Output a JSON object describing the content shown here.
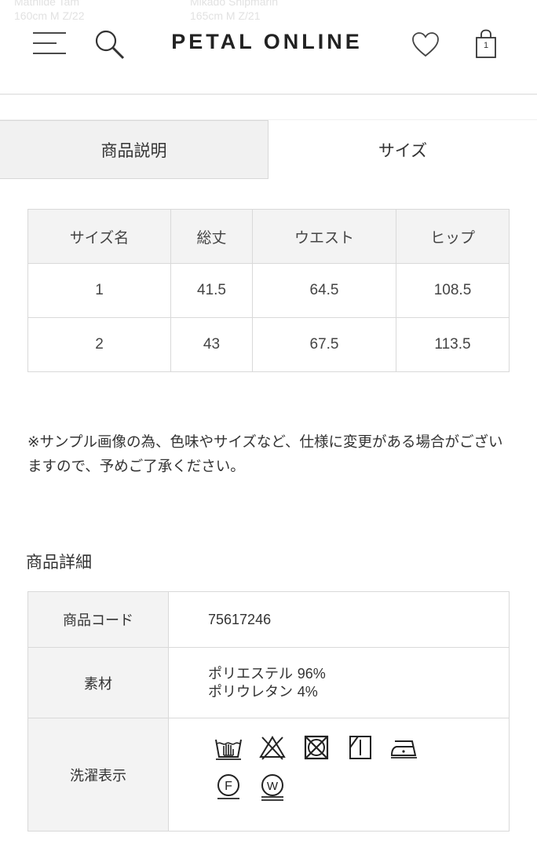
{
  "ghost": {
    "line1": "Mathilde Tam",
    "line2": "160cm   M Z/22",
    "line3": "Mikado Shipmarin",
    "line4": "165cm   M Z/21"
  },
  "header": {
    "logo": "PETAL ONLINE",
    "cart_count": "1",
    "icons": [
      "menu-icon",
      "search-icon",
      "heart-icon",
      "shopping-bag-icon"
    ]
  },
  "tabs": [
    {
      "label": "商品説明",
      "active": false
    },
    {
      "label": "サイズ",
      "active": true
    }
  ],
  "size_table": {
    "headers": [
      "サイズ名",
      "総丈",
      "ウエスト",
      "ヒップ"
    ],
    "rows": [
      [
        "1",
        "41.5",
        "64.5",
        "108.5"
      ],
      [
        "2",
        "43",
        "67.5",
        "113.5"
      ]
    ]
  },
  "note": "※サンプル画像の為、色味やサイズなど、仕様に変更がある場合がございますので、予めご了承ください。",
  "details": {
    "heading": "商品詳細",
    "code_label": "商品コード",
    "code_value": "75617246",
    "material_label": "素材",
    "material_lines": [
      {
        "name": "ポリエステル",
        "pct": "96%"
      },
      {
        "name": "ポリウレタン",
        "pct": "4%"
      }
    ],
    "care_label": "洗濯表示",
    "care_icons": [
      "hand-wash-icon",
      "no-bleach-icon",
      "no-tumble-dry-icon",
      "shade-line-dry-icon",
      "low-iron-icon",
      "dry-clean-f-icon",
      "wet-clean-w-icon"
    ],
    "care_letters": {
      "dry_clean": "F",
      "wet_clean": "W"
    }
  },
  "colors": {
    "text": "#333333",
    "border": "#d9d9d9",
    "header_cell": "#f3f3f3",
    "tab_inactive": "#f1f1f1"
  }
}
